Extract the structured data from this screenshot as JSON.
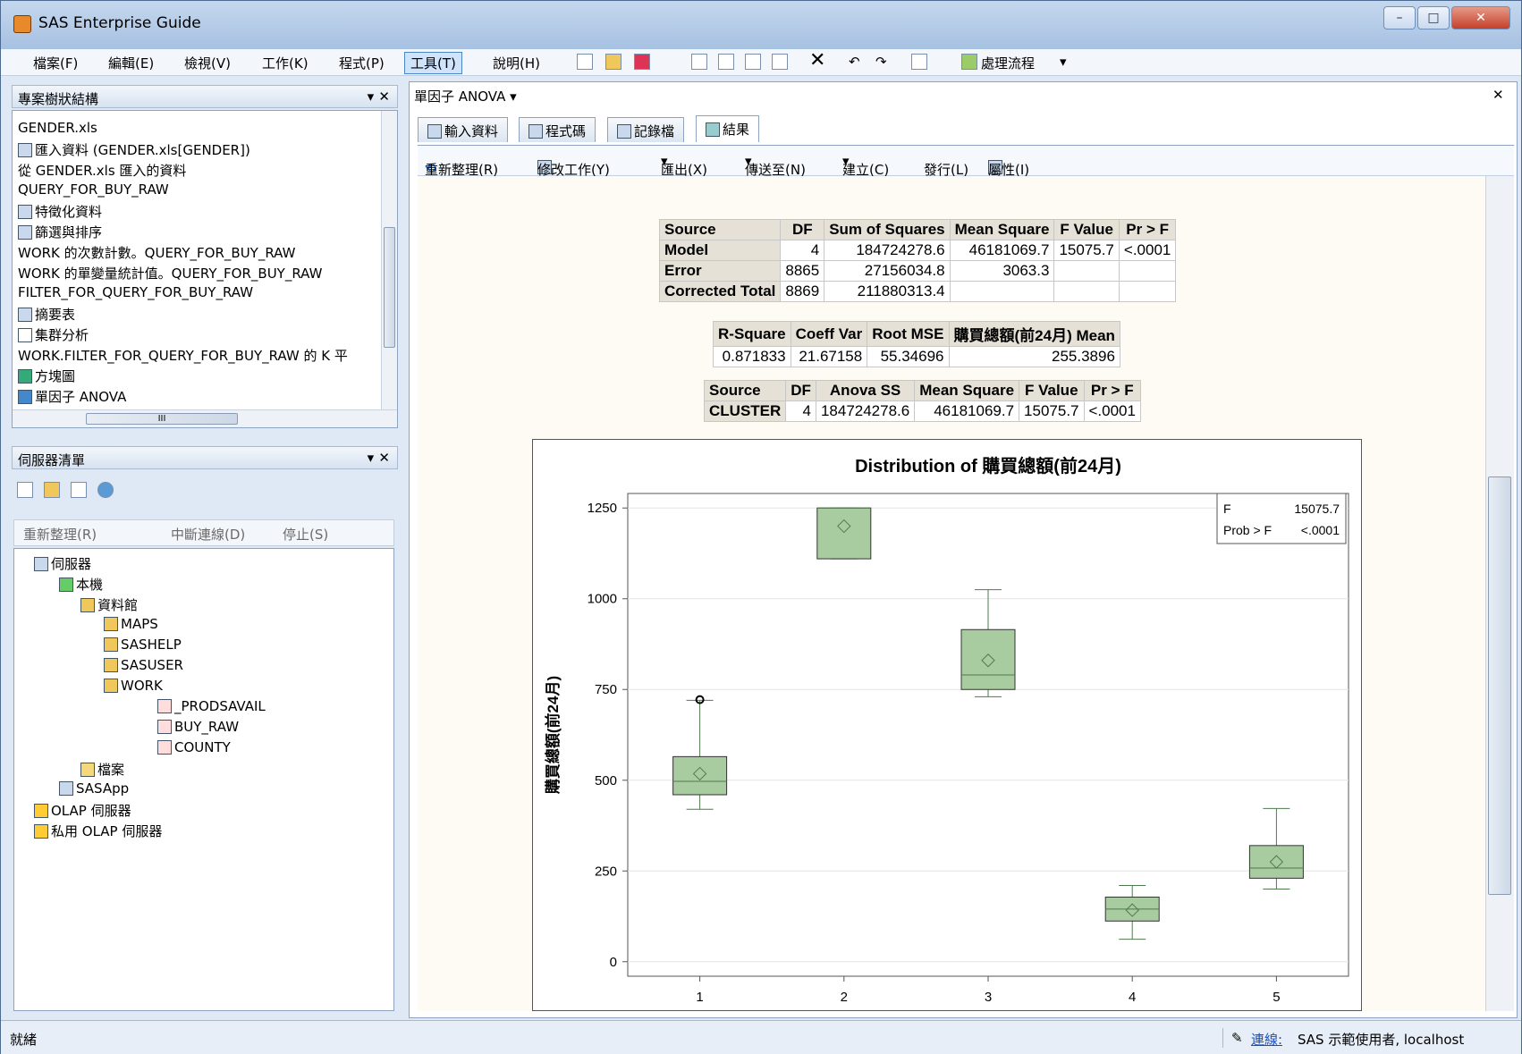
{
  "window": {
    "title": "SAS Enterprise Guide"
  },
  "menu": [
    "檔案(F)",
    "編輯(E)",
    "檢視(V)",
    "工作(K)",
    "程式(P)",
    "工具(T)",
    "說明(H)"
  ],
  "toolbar": {
    "process_flow": "處理流程"
  },
  "project_tree": {
    "title": "專案樹狀結構",
    "items": [
      "GENDER.xls",
      "匯入資料 (GENDER.xls[GENDER])",
      "從 GENDER.xls 匯入的資料",
      "QUERY_FOR_BUY_RAW",
      "特徵化資料",
      "篩選與排序",
      "WORK 的次數計數。QUERY_FOR_BUY_RAW",
      "WORK 的單變量統計值。QUERY_FOR_BUY_RAW",
      "FILTER_FOR_QUERY_FOR_BUY_RAW",
      "摘要表",
      "集群分析",
      "WORK.FILTER_FOR_QUERY_FOR_BUY_RAW 的 K 平",
      "方塊圖",
      "單因子 ANOVA"
    ],
    "scroll_mark": "III"
  },
  "server_list": {
    "title": "伺服器清單",
    "refresh": "重新整理(R)",
    "disconnect": "中斷連線(D)",
    "stop": "停止(S)",
    "tree": [
      "伺服器",
      "本機",
      "資料館",
      "MAPS",
      "SASHELP",
      "SASUSER",
      "WORK",
      "_PRODSAVAIL",
      "BUY_RAW",
      "COUNTY",
      "檔案",
      "SASApp",
      "OLAP 伺服器",
      "私用 OLAP 伺服器"
    ]
  },
  "doc_tab": {
    "title": "單因子 ANOVA"
  },
  "tabs": [
    "輸入資料",
    "程式碼",
    "記錄檔",
    "結果"
  ],
  "result_toolbar": {
    "refresh": "重新整理(R)",
    "modify": "修改工作(Y)",
    "export": "匯出(X)",
    "send": "傳送至(N)",
    "create": "建立(C)",
    "publish": "發行(L)",
    "props": "屬性(I)"
  },
  "anova_table": {
    "headers": [
      "Source",
      "DF",
      "Sum of Squares",
      "Mean Square",
      "F Value",
      "Pr > F"
    ],
    "rows": [
      [
        "Model",
        "4",
        "184724278.6",
        "46181069.7",
        "15075.7",
        "<.0001"
      ],
      [
        "Error",
        "8865",
        "27156034.8",
        "3063.3",
        "",
        ""
      ],
      [
        "Corrected Total",
        "8869",
        "211880313.4",
        "",
        "",
        ""
      ]
    ]
  },
  "fit_table": {
    "headers": [
      "R-Square",
      "Coeff Var",
      "Root MSE",
      "購買總額(前24月) Mean"
    ],
    "row": [
      "0.871833",
      "21.67158",
      "55.34696",
      "255.3896"
    ]
  },
  "type_table": {
    "headers": [
      "Source",
      "DF",
      "Anova SS",
      "Mean Square",
      "F Value",
      "Pr > F"
    ],
    "row": [
      "CLUSTER",
      "4",
      "184724278.6",
      "46181069.7",
      "15075.7",
      "<.0001"
    ]
  },
  "chart_data": {
    "type": "box",
    "title": "Distribution of 購買總額(前24月)",
    "ylabel": "購買總額(前24月)",
    "categories": [
      "1",
      "2",
      "3",
      "4",
      "5"
    ],
    "yticks": [
      "0",
      "250",
      "500",
      "750",
      "1000",
      "1250"
    ],
    "ylim": [
      -40,
      1290
    ],
    "inset": {
      "f_label": "F",
      "f_value": "15075.7",
      "p_label": "Prob > F",
      "p_value": "<.0001"
    },
    "boxes": [
      {
        "cat": "1",
        "min": 420,
        "q1": 460,
        "median": 497,
        "q3": 565,
        "max": 720,
        "mean": 518,
        "outliers": [
          722
        ]
      },
      {
        "cat": "2",
        "min": 1110,
        "q1": 1110,
        "median": 1250,
        "q3": 1250,
        "max": 1250,
        "mean": 1200,
        "outliers": []
      },
      {
        "cat": "3",
        "min": 730,
        "q1": 750,
        "median": 790,
        "q3": 915,
        "max": 1025,
        "mean": 830,
        "outliers": []
      },
      {
        "cat": "4",
        "min": 62,
        "q1": 112,
        "median": 145,
        "q3": 178,
        "max": 210,
        "mean": 142,
        "outliers": []
      },
      {
        "cat": "5",
        "min": 200,
        "q1": 230,
        "median": 258,
        "q3": 320,
        "max": 422,
        "mean": 275,
        "outliers": []
      }
    ]
  },
  "status": {
    "ready": "就緒",
    "conn_link": "連線:",
    "conn_user": "SAS 示範使用者, localhost"
  }
}
